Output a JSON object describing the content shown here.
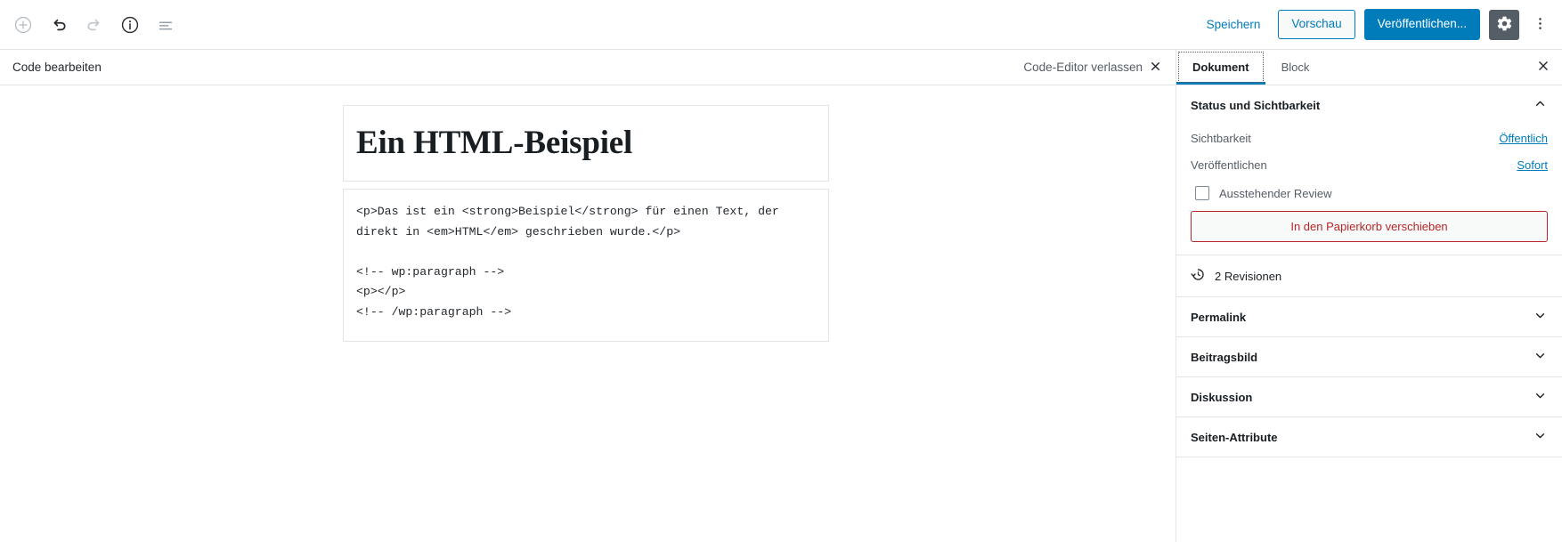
{
  "toolbar": {
    "icons": [
      {
        "name": "add-block-icon",
        "label": "Block hinzufügen",
        "state": "disabled"
      },
      {
        "name": "undo-icon",
        "label": "Rückgängig",
        "state": "enabled"
      },
      {
        "name": "redo-icon",
        "label": "Wiederholen",
        "state": "disabled"
      },
      {
        "name": "info-icon",
        "label": "Inhaltsstruktur",
        "state": "enabled"
      },
      {
        "name": "list-view-icon",
        "label": "Block-Navigation",
        "state": "enabled"
      }
    ],
    "save_label": "Speichern",
    "preview_label": "Vorschau",
    "publish_label": "Veröffentlichen...",
    "settings_label": "Einstellungen",
    "more_label": "Weitere Werkzeuge & Optionen"
  },
  "modebar": {
    "title": "Code bearbeiten",
    "leave_label": "Code-Editor verlassen"
  },
  "editor": {
    "title": "Ein HTML-Beispiel",
    "code": "<p>Das ist ein <strong>Beispiel</strong> für einen Text, der direkt in <em>HTML</em> geschrieben wurde.</p>\n\n<!-- wp:paragraph -->\n<p></p>\n<!-- /wp:paragraph -->"
  },
  "sidebar": {
    "tabs": [
      {
        "label": "Dokument",
        "active": true
      },
      {
        "label": "Block",
        "active": false
      }
    ],
    "close_label": "Schließen",
    "status_panel": {
      "title": "Status und Sichtbarkeit",
      "expanded": true,
      "visibility_label": "Sichtbarkeit",
      "visibility_value": "Öffentlich",
      "publish_label": "Veröffentlichen",
      "publish_value": "Sofort",
      "pending_review_label": "Ausstehender Review",
      "pending_review_checked": false,
      "trash_label": "In den Papierkorb verschieben"
    },
    "revisions": {
      "label": "2 Revisionen",
      "count": 2
    },
    "panels": [
      {
        "title": "Permalink",
        "expanded": false
      },
      {
        "title": "Beitragsbild",
        "expanded": false
      },
      {
        "title": "Diskussion",
        "expanded": false
      },
      {
        "title": "Seiten-Attribute",
        "expanded": false
      }
    ]
  },
  "colors": {
    "accent": "#007cba",
    "danger": "#b52727",
    "text": "#23282d",
    "muted": "#555d66",
    "border": "#e2e4e7",
    "gear_bg": "#555d66"
  }
}
